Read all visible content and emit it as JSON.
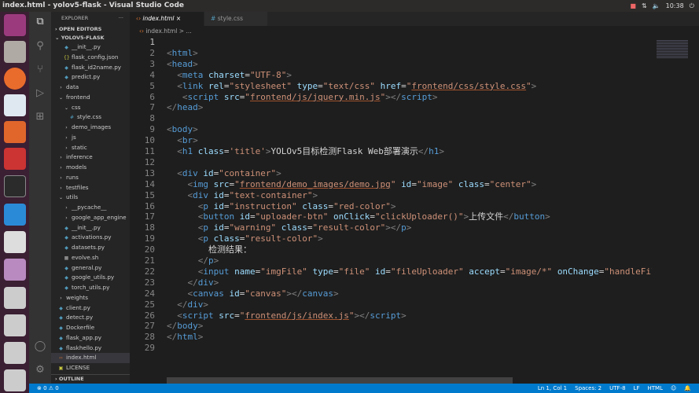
{
  "window": {
    "title": "index.html - yolov5-flask - Visual Studio Code",
    "time": "10:38"
  },
  "sidebar": {
    "explorer": "EXPLORER",
    "more": "···",
    "open_editors": "OPEN EDITORS",
    "project": "YOLOV5-FLASK",
    "outline": "OUTLINE",
    "items": [
      {
        "label": "__init__.py",
        "depth": 2,
        "kind": "py"
      },
      {
        "label": "flask_config.json",
        "depth": 2,
        "kind": "json"
      },
      {
        "label": "flask_id2name.py",
        "depth": 2,
        "kind": "py"
      },
      {
        "label": "predict.py",
        "depth": 2,
        "kind": "py"
      },
      {
        "label": "data",
        "depth": 1,
        "kind": "closed"
      },
      {
        "label": "frontend",
        "depth": 1,
        "kind": "open"
      },
      {
        "label": "css",
        "depth": 2,
        "kind": "open"
      },
      {
        "label": "style.css",
        "depth": 3,
        "kind": "css"
      },
      {
        "label": "demo_images",
        "depth": 2,
        "kind": "closed"
      },
      {
        "label": "js",
        "depth": 2,
        "kind": "closed"
      },
      {
        "label": "static",
        "depth": 2,
        "kind": "closed"
      },
      {
        "label": "inference",
        "depth": 1,
        "kind": "closed"
      },
      {
        "label": "models",
        "depth": 1,
        "kind": "closed"
      },
      {
        "label": "runs",
        "depth": 1,
        "kind": "closed"
      },
      {
        "label": "testfiles",
        "depth": 1,
        "kind": "closed"
      },
      {
        "label": "utils",
        "depth": 1,
        "kind": "open"
      },
      {
        "label": "__pycache__",
        "depth": 2,
        "kind": "closed"
      },
      {
        "label": "google_app_engine",
        "depth": 2,
        "kind": "closed"
      },
      {
        "label": "__init__.py",
        "depth": 2,
        "kind": "py"
      },
      {
        "label": "activations.py",
        "depth": 2,
        "kind": "py"
      },
      {
        "label": "datasets.py",
        "depth": 2,
        "kind": "py"
      },
      {
        "label": "evolve.sh",
        "depth": 2,
        "kind": "sh"
      },
      {
        "label": "general.py",
        "depth": 2,
        "kind": "py"
      },
      {
        "label": "google_utils.py",
        "depth": 2,
        "kind": "py"
      },
      {
        "label": "torch_utils.py",
        "depth": 2,
        "kind": "py"
      },
      {
        "label": "weights",
        "depth": 1,
        "kind": "closed"
      },
      {
        "label": "client.py",
        "depth": 1,
        "kind": "py"
      },
      {
        "label": "detect.py",
        "depth": 1,
        "kind": "py"
      },
      {
        "label": "Dockerfile",
        "depth": 1,
        "kind": "docker"
      },
      {
        "label": "flask_app.py",
        "depth": 1,
        "kind": "py"
      },
      {
        "label": "flaskhello.py",
        "depth": 1,
        "kind": "py"
      },
      {
        "label": "index.html",
        "depth": 1,
        "kind": "html",
        "selected": true
      },
      {
        "label": "LICENSE",
        "depth": 1,
        "kind": "lic"
      }
    ]
  },
  "tabs": [
    {
      "label": "index.html",
      "active": true,
      "icon": "html-icon"
    },
    {
      "label": "style.css",
      "active": false,
      "icon": "css-icon"
    }
  ],
  "breadcrumb": [
    "index.html",
    "> ..."
  ],
  "code": [
    [],
    [
      [
        "b",
        "<"
      ],
      [
        "t",
        "html"
      ],
      [
        "b",
        ">"
      ]
    ],
    [
      [
        "b",
        "<"
      ],
      [
        "t",
        "head"
      ],
      [
        "b",
        ">"
      ]
    ],
    [
      [
        "x",
        "  "
      ],
      [
        "b",
        "<"
      ],
      [
        "t",
        "meta"
      ],
      [
        "x",
        " "
      ],
      [
        "a",
        "charset"
      ],
      [
        "x",
        "="
      ],
      [
        "s",
        "\"UTF-8\""
      ],
      [
        "b",
        ">"
      ]
    ],
    [
      [
        "x",
        "  "
      ],
      [
        "b",
        "<"
      ],
      [
        "t",
        "link"
      ],
      [
        "x",
        " "
      ],
      [
        "a",
        "rel"
      ],
      [
        "x",
        "="
      ],
      [
        "s",
        "\"stylesheet\""
      ],
      [
        "x",
        " "
      ],
      [
        "a",
        "type"
      ],
      [
        "x",
        "="
      ],
      [
        "s",
        "\"text/css\""
      ],
      [
        "x",
        " "
      ],
      [
        "a",
        "href"
      ],
      [
        "x",
        "="
      ],
      [
        "s",
        "\""
      ],
      [
        "u",
        "frontend/css/style.css"
      ],
      [
        "s",
        "\""
      ],
      [
        "b",
        ">"
      ]
    ],
    [
      [
        "x",
        "   "
      ],
      [
        "b",
        "<"
      ],
      [
        "t",
        "script"
      ],
      [
        "x",
        " "
      ],
      [
        "a",
        "src"
      ],
      [
        "x",
        "="
      ],
      [
        "s",
        "\""
      ],
      [
        "u",
        "frontend/js/jquery.min.js"
      ],
      [
        "s",
        "\""
      ],
      [
        "b",
        "></"
      ],
      [
        "t",
        "script"
      ],
      [
        "b",
        ">"
      ]
    ],
    [
      [
        "b",
        "</"
      ],
      [
        "t",
        "head"
      ],
      [
        "b",
        ">"
      ]
    ],
    [],
    [
      [
        "b",
        "<"
      ],
      [
        "t",
        "body"
      ],
      [
        "b",
        ">"
      ]
    ],
    [
      [
        "x",
        "  "
      ],
      [
        "b",
        "<"
      ],
      [
        "t",
        "br"
      ],
      [
        "b",
        ">"
      ]
    ],
    [
      [
        "x",
        "  "
      ],
      [
        "b",
        "<"
      ],
      [
        "t",
        "h1"
      ],
      [
        "x",
        " "
      ],
      [
        "a",
        "class"
      ],
      [
        "x",
        "="
      ],
      [
        "s",
        "'title'"
      ],
      [
        "b",
        ">"
      ],
      [
        "x",
        "YOLOv5目标检测Flask Web部署演示"
      ],
      [
        "b",
        "</"
      ],
      [
        "t",
        "h1"
      ],
      [
        "b",
        ">"
      ]
    ],
    [],
    [
      [
        "x",
        "  "
      ],
      [
        "b",
        "<"
      ],
      [
        "t",
        "div"
      ],
      [
        "x",
        " "
      ],
      [
        "a",
        "id"
      ],
      [
        "x",
        "="
      ],
      [
        "s",
        "\"container\""
      ],
      [
        "b",
        ">"
      ]
    ],
    [
      [
        "x",
        "    "
      ],
      [
        "b",
        "<"
      ],
      [
        "t",
        "img"
      ],
      [
        "x",
        " "
      ],
      [
        "a",
        "src"
      ],
      [
        "x",
        "="
      ],
      [
        "s",
        "\""
      ],
      [
        "u",
        "frontend/demo_images/demo.jpg"
      ],
      [
        "s",
        "\""
      ],
      [
        "x",
        " "
      ],
      [
        "a",
        "id"
      ],
      [
        "x",
        "="
      ],
      [
        "s",
        "\"image\""
      ],
      [
        "x",
        " "
      ],
      [
        "a",
        "class"
      ],
      [
        "x",
        "="
      ],
      [
        "s",
        "\"center\""
      ],
      [
        "b",
        ">"
      ]
    ],
    [
      [
        "x",
        "    "
      ],
      [
        "b",
        "<"
      ],
      [
        "t",
        "div"
      ],
      [
        "x",
        " "
      ],
      [
        "a",
        "id"
      ],
      [
        "x",
        "="
      ],
      [
        "s",
        "\"text-container\""
      ],
      [
        "b",
        ">"
      ]
    ],
    [
      [
        "x",
        "      "
      ],
      [
        "b",
        "<"
      ],
      [
        "t",
        "p"
      ],
      [
        "x",
        " "
      ],
      [
        "a",
        "id"
      ],
      [
        "x",
        "="
      ],
      [
        "s",
        "\"instruction\""
      ],
      [
        "x",
        " "
      ],
      [
        "a",
        "class"
      ],
      [
        "x",
        "="
      ],
      [
        "s",
        "\"red-color\""
      ],
      [
        "b",
        ">"
      ]
    ],
    [
      [
        "x",
        "      "
      ],
      [
        "b",
        "<"
      ],
      [
        "t",
        "button"
      ],
      [
        "x",
        " "
      ],
      [
        "a",
        "id"
      ],
      [
        "x",
        "="
      ],
      [
        "s",
        "\"uploader-btn\""
      ],
      [
        "x",
        " "
      ],
      [
        "a",
        "onClick"
      ],
      [
        "x",
        "="
      ],
      [
        "s",
        "\"clickUploader()\""
      ],
      [
        "b",
        ">"
      ],
      [
        "x",
        "上传文件"
      ],
      [
        "b",
        "</"
      ],
      [
        "t",
        "button"
      ],
      [
        "b",
        ">"
      ]
    ],
    [
      [
        "x",
        "      "
      ],
      [
        "b",
        "<"
      ],
      [
        "t",
        "p"
      ],
      [
        "x",
        " "
      ],
      [
        "a",
        "id"
      ],
      [
        "x",
        "="
      ],
      [
        "s",
        "\"warning\""
      ],
      [
        "x",
        " "
      ],
      [
        "a",
        "class"
      ],
      [
        "x",
        "="
      ],
      [
        "s",
        "\"result-color\""
      ],
      [
        "b",
        "></"
      ],
      [
        "t",
        "p"
      ],
      [
        "b",
        ">"
      ]
    ],
    [
      [
        "x",
        "      "
      ],
      [
        "b",
        "<"
      ],
      [
        "t",
        "p"
      ],
      [
        "x",
        " "
      ],
      [
        "a",
        "class"
      ],
      [
        "x",
        "="
      ],
      [
        "s",
        "\"result-color\""
      ],
      [
        "b",
        ">"
      ]
    ],
    [
      [
        "x",
        "        检测结果："
      ]
    ],
    [
      [
        "x",
        "      "
      ],
      [
        "b",
        "</"
      ],
      [
        "t",
        "p"
      ],
      [
        "b",
        ">"
      ]
    ],
    [
      [
        "x",
        "      "
      ],
      [
        "b",
        "<"
      ],
      [
        "t",
        "input"
      ],
      [
        "x",
        " "
      ],
      [
        "a",
        "name"
      ],
      [
        "x",
        "="
      ],
      [
        "s",
        "\"imgFile\""
      ],
      [
        "x",
        " "
      ],
      [
        "a",
        "type"
      ],
      [
        "x",
        "="
      ],
      [
        "s",
        "\"file\""
      ],
      [
        "x",
        " "
      ],
      [
        "a",
        "id"
      ],
      [
        "x",
        "="
      ],
      [
        "s",
        "\"fileUploader\""
      ],
      [
        "x",
        " "
      ],
      [
        "a",
        "accept"
      ],
      [
        "x",
        "="
      ],
      [
        "s",
        "\"image/*\""
      ],
      [
        "x",
        " "
      ],
      [
        "a",
        "onChange"
      ],
      [
        "x",
        "="
      ],
      [
        "s",
        "\"handleFiles()\""
      ]
    ],
    [
      [
        "x",
        "    "
      ],
      [
        "b",
        "</"
      ],
      [
        "t",
        "div"
      ],
      [
        "b",
        ">"
      ]
    ],
    [
      [
        "x",
        "    "
      ],
      [
        "b",
        "<"
      ],
      [
        "t",
        "canvas"
      ],
      [
        "x",
        " "
      ],
      [
        "a",
        "id"
      ],
      [
        "x",
        "="
      ],
      [
        "s",
        "\"canvas\""
      ],
      [
        "b",
        "></"
      ],
      [
        "t",
        "canvas"
      ],
      [
        "b",
        ">"
      ]
    ],
    [
      [
        "x",
        "  "
      ],
      [
        "b",
        "</"
      ],
      [
        "t",
        "div"
      ],
      [
        "b",
        ">"
      ]
    ],
    [
      [
        "x",
        "  "
      ],
      [
        "b",
        "<"
      ],
      [
        "t",
        "script"
      ],
      [
        "x",
        " "
      ],
      [
        "a",
        "src"
      ],
      [
        "x",
        "="
      ],
      [
        "s",
        "\""
      ],
      [
        "u",
        "frontend/js/index.js"
      ],
      [
        "s",
        "\""
      ],
      [
        "b",
        "></"
      ],
      [
        "t",
        "script"
      ],
      [
        "b",
        ">"
      ]
    ],
    [
      [
        "b",
        "</"
      ],
      [
        "t",
        "body"
      ],
      [
        "b",
        ">"
      ]
    ],
    [
      [
        "b",
        "</"
      ],
      [
        "t",
        "html"
      ],
      [
        "b",
        ">"
      ]
    ],
    []
  ],
  "status": {
    "errors": "⊗ 0",
    "warnings": "⚠ 0",
    "position": "Ln 1, Col 1",
    "spaces": "Spaces: 2",
    "encoding": "UTF-8",
    "eol": "LF",
    "language": "HTML"
  },
  "colors": {
    "status_bar": "#007acc",
    "dock": "#3b1f33"
  }
}
